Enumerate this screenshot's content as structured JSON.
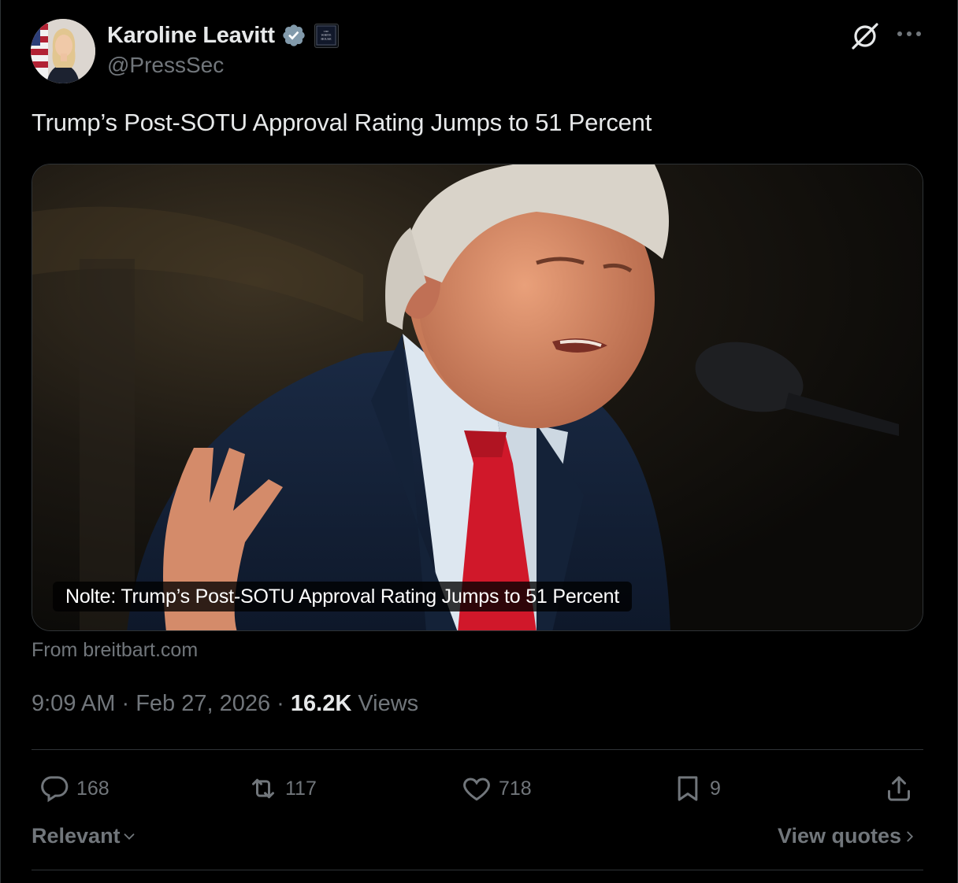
{
  "author": {
    "name": "Karoline Leavitt",
    "handle": "@PressSec",
    "affiliation_badge_text": "THE WHITE HOUSE"
  },
  "icons": {
    "verified": "verified-badge-icon",
    "grok": "grok-icon",
    "more": "more-icon",
    "reply": "reply-icon",
    "repost": "repost-icon",
    "like": "heart-icon",
    "bookmark": "bookmark-icon",
    "share": "share-icon"
  },
  "tweet": {
    "text": "Trump’s Post-SOTU Approval Rating Jumps to 51 Percent"
  },
  "card": {
    "title": "Nolte: Trump’s Post-SOTU Approval Rating Jumps to 51 Percent",
    "source": "From breitbart.com"
  },
  "meta": {
    "time": "9:09 AM",
    "sep1": " · ",
    "date": "Feb 27, 2026",
    "sep2": " · ",
    "views_count": "16.2K",
    "views_label": " Views"
  },
  "actions": {
    "replies": "168",
    "reposts": "117",
    "likes": "718",
    "bookmarks": "9"
  },
  "footer": {
    "sort_label": "Relevant",
    "view_quotes_label": "View quotes"
  },
  "colors": {
    "background": "#000000",
    "text_primary": "#e7e9ea",
    "text_secondary": "#71767b",
    "border": "#2f3336",
    "verified_blue": "#829aab",
    "tie_red": "#d0182a"
  }
}
